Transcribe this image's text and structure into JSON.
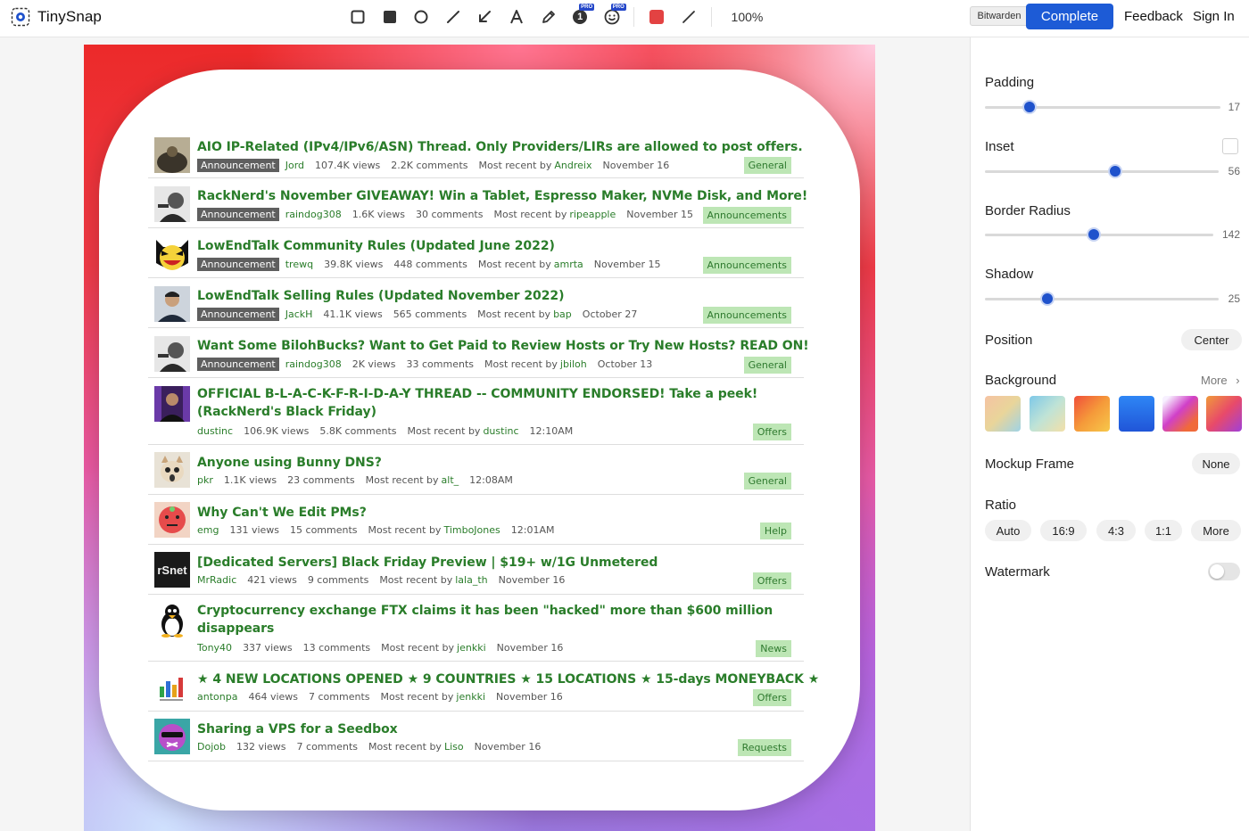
{
  "app": {
    "name": "TinySnap"
  },
  "toolbar": {
    "tools": [
      "rectangle-outline",
      "rectangle-filled",
      "circle",
      "line",
      "arrow",
      "text",
      "pen",
      "step-number",
      "emoji",
      "color",
      "stroke"
    ],
    "pro_badge": "PRO",
    "step_number": "1",
    "color": "#e34242",
    "zoom": "100%"
  },
  "header": {
    "bitwarden_label": "Bitwarden",
    "complete_label": "Complete",
    "feedback_label": "Feedback",
    "signin_label": "Sign In"
  },
  "threads": [
    {
      "title": "AIO IP-Related (IPv4/IPv6/ASN) Thread. Only Providers/LIRs are allowed to post offers.",
      "badge": "Announcement",
      "user": "Jord",
      "views": "107.4K views",
      "comments": "2.2K comments",
      "recent_prefix": "Most recent by",
      "recent_user": "Andreix",
      "date": "November 16",
      "category": "General"
    },
    {
      "title": "RackNerd's November GIVEAWAY! Win a Tablet, Espresso Maker, NVMe Disk, and More!",
      "badge": "Announcement",
      "user": "raindog308",
      "views": "1.6K views",
      "comments": "30 comments",
      "recent_prefix": "Most recent by",
      "recent_user": "ripeapple",
      "date": "November 15",
      "category": "Announcements"
    },
    {
      "title": "LowEndTalk Community Rules (Updated June 2022)",
      "badge": "Announcement",
      "user": "trewq",
      "views": "39.8K views",
      "comments": "448 comments",
      "recent_prefix": "Most recent by",
      "recent_user": "amrta",
      "date": "November 15",
      "category": "Announcements"
    },
    {
      "title": "LowEndTalk Selling Rules (Updated November 2022)",
      "badge": "Announcement",
      "user": "JackH",
      "views": "41.1K views",
      "comments": "565 comments",
      "recent_prefix": "Most recent by",
      "recent_user": "bap",
      "date": "October 27",
      "category": "Announcements"
    },
    {
      "title": "Want Some BilohBucks? Want to Get Paid to Review Hosts or Try New Hosts? READ ON!",
      "badge": "Announcement",
      "user": "raindog308",
      "views": "2K views",
      "comments": "33 comments",
      "recent_prefix": "Most recent by",
      "recent_user": "jbiloh",
      "date": "October 13",
      "category": "General"
    },
    {
      "title": "OFFICIAL B-L-A-C-K-F-R-I-D-A-Y THREAD -- COMMUNITY ENDORSED! Take a peek! (RackNerd's Black Friday)",
      "badge": "",
      "user": "dustinc",
      "views": "106.9K views",
      "comments": "5.8K comments",
      "recent_prefix": "Most recent by",
      "recent_user": "dustinc",
      "date": "12:10AM",
      "category": "Offers"
    },
    {
      "title": "Anyone using Bunny DNS?",
      "badge": "",
      "user": "pkr",
      "views": "1.1K views",
      "comments": "23 comments",
      "recent_prefix": "Most recent by",
      "recent_user": "alt_",
      "date": "12:08AM",
      "category": "General"
    },
    {
      "title": "Why Can't We Edit PMs?",
      "badge": "",
      "user": "emg",
      "views": "131 views",
      "comments": "15 comments",
      "recent_prefix": "Most recent by",
      "recent_user": "TimboJones",
      "date": "12:01AM",
      "category": "Help"
    },
    {
      "title": "[Dedicated Servers] Black Friday Preview | $19+ w/1G Unmetered",
      "badge": "",
      "user": "MrRadic",
      "views": "421 views",
      "comments": "9 comments",
      "recent_prefix": "Most recent by",
      "recent_user": "lala_th",
      "date": "November 16",
      "category": "Offers"
    },
    {
      "title": "Cryptocurrency exchange FTX claims it has been \"hacked\" more than $600 million disappears",
      "badge": "",
      "user": "Tony40",
      "views": "337 views",
      "comments": "13 comments",
      "recent_prefix": "Most recent by",
      "recent_user": "jenkki",
      "date": "November 16",
      "category": "News"
    },
    {
      "title": "★ 4 NEW LOCATIONS OPENED ★ 9 COUNTRIES ★ 15 LOCATIONS ★ 15-days MONEYBACK ★",
      "badge": "",
      "user": "antonpa",
      "views": "464 views",
      "comments": "7 comments",
      "recent_prefix": "Most recent by",
      "recent_user": "jenkki",
      "date": "November 16",
      "category": "Offers"
    },
    {
      "title": "Sharing a VPS for a Seedbox",
      "badge": "",
      "user": "Dojob",
      "views": "132 views",
      "comments": "7 comments",
      "recent_prefix": "Most recent by",
      "recent_user": "Liso",
      "date": "November 16",
      "category": "Requests"
    }
  ],
  "avatar_labels": {
    "rsnet": "rSnet"
  },
  "sidebar": {
    "padding": {
      "label": "Padding",
      "value": 17,
      "max": 100
    },
    "inset": {
      "label": "Inset",
      "value": 56,
      "max": 100
    },
    "border_radius": {
      "label": "Border Radius",
      "value": 142,
      "max": 300
    },
    "shadow": {
      "label": "Shadow",
      "value": 25,
      "max": 100
    },
    "position": {
      "label": "Position",
      "value": "Center"
    },
    "background": {
      "label": "Background",
      "more": "More"
    },
    "mockup_frame": {
      "label": "Mockup Frame",
      "value": "None"
    },
    "ratio": {
      "label": "Ratio",
      "options": [
        "Auto",
        "16:9",
        "4:3",
        "1:1",
        "More"
      ]
    },
    "watermark": {
      "label": "Watermark"
    }
  },
  "colors": {
    "accent": "#1f52cc",
    "complete_button": "#1d5bd6",
    "thread_title": "#2a7d2a",
    "category_badge": "#bde6b5",
    "announcement_badge": "#5f5f5f"
  }
}
